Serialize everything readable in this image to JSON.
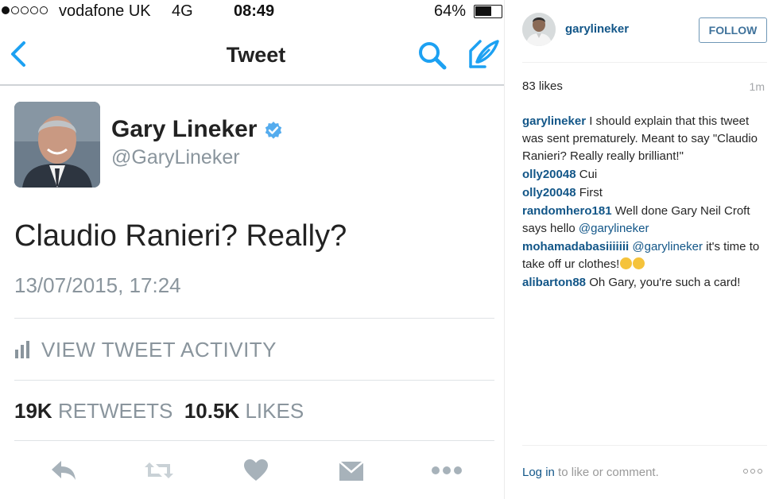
{
  "status_bar": {
    "carrier": "vodafone UK",
    "network": "4G",
    "time": "08:49",
    "battery": "64%",
    "signal_bars": 1,
    "signal_max": 5
  },
  "nav": {
    "title": "Tweet",
    "icons": [
      "chevron-left-icon",
      "search-icon",
      "compose-icon"
    ]
  },
  "tweet": {
    "author_name": "Gary Lineker",
    "author_handle": "@GaryLineker",
    "verified": true,
    "text": "Claudio Ranieri? Really?",
    "timestamp": "13/07/2015, 17:24",
    "activity_label": "VIEW TWEET ACTIVITY",
    "retweets_count": "19K",
    "retweets_label": "RETWEETS",
    "likes_count": "10.5K",
    "likes_label": "LIKES",
    "actions": [
      "reply-icon",
      "retweet-icon",
      "like-heart-icon",
      "direct-message-icon",
      "more-icon"
    ]
  },
  "instagram": {
    "username": "garylineker",
    "follow_label": "FOLLOW",
    "likes": "83 likes",
    "time_ago": "1m",
    "comments": [
      {
        "user": "garylineker",
        "text": "I should explain that this tweet was sent prematurely. Meant to say \"Claudio Ranieri? Really really brilliant!\""
      },
      {
        "user": "olly20048",
        "text": "Cui"
      },
      {
        "user": "olly20048",
        "text": "First"
      },
      {
        "user": "randomhero181",
        "text": "Well done Gary Neil Croft says hello ",
        "mention": "@garylineker"
      },
      {
        "user": "mohamadabasiiiiiii",
        "mention": "@garylineker",
        "text": " it's time to take off ur clothes!"
      },
      {
        "user": "alibarton88",
        "text": "Oh Gary, you're such a card!"
      }
    ],
    "login_link": "Log in",
    "login_suffix": " to like or comment.",
    "accent_color": "#125688"
  },
  "colors": {
    "twitter_blue": "#1da1f2",
    "gray_text": "#8a959d"
  }
}
